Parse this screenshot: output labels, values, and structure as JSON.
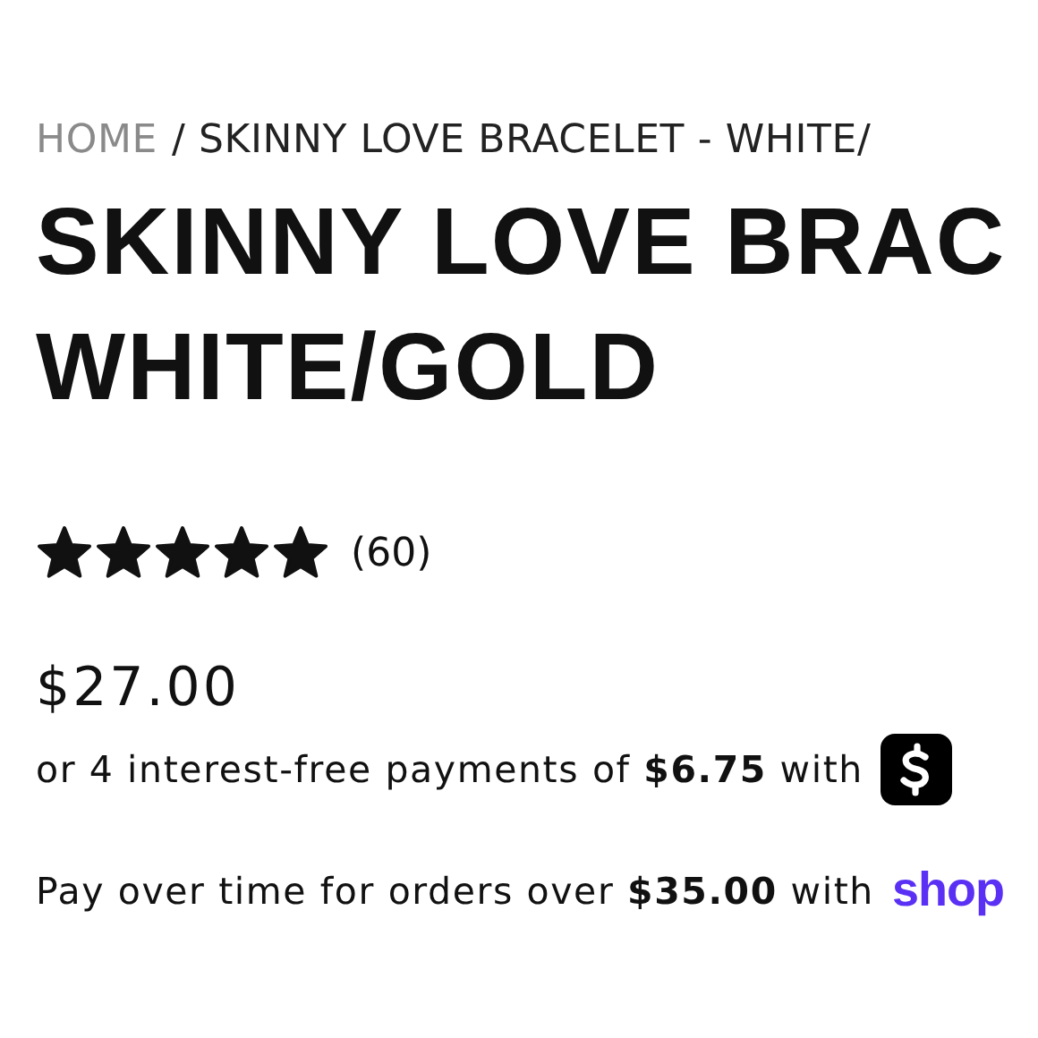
{
  "breadcrumb": {
    "home": "HOME",
    "current": "/ SKINNY LOVE BRACELET - WHITE/"
  },
  "title": [
    "SKINNY LOVE BRAC",
    "WHITE/GOLD"
  ],
  "rating": {
    "stars": 5,
    "count": "(60)"
  },
  "price": "$27.00",
  "installments": "or 4 interest-free payments of **$6.75** with",
  "pay_over_time": {
    "text": "Pay over time for orders over **$35.00** with",
    "logo": "shop"
  }
}
